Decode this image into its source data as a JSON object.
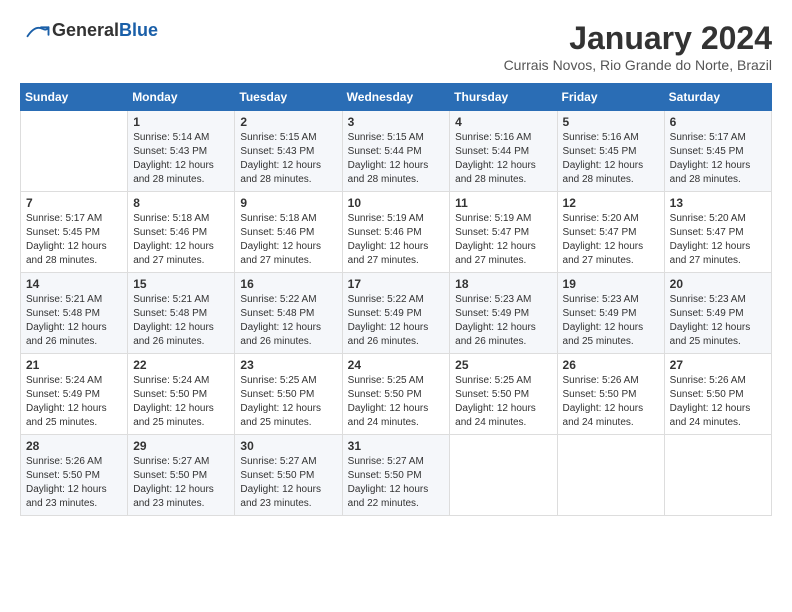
{
  "header": {
    "logo_general": "General",
    "logo_blue": "Blue",
    "title": "January 2024",
    "subtitle": "Currais Novos, Rio Grande do Norte, Brazil"
  },
  "columns": [
    "Sunday",
    "Monday",
    "Tuesday",
    "Wednesday",
    "Thursday",
    "Friday",
    "Saturday"
  ],
  "weeks": [
    [
      {
        "day": "",
        "info": ""
      },
      {
        "day": "1",
        "info": "Sunrise: 5:14 AM\nSunset: 5:43 PM\nDaylight: 12 hours\nand 28 minutes."
      },
      {
        "day": "2",
        "info": "Sunrise: 5:15 AM\nSunset: 5:43 PM\nDaylight: 12 hours\nand 28 minutes."
      },
      {
        "day": "3",
        "info": "Sunrise: 5:15 AM\nSunset: 5:44 PM\nDaylight: 12 hours\nand 28 minutes."
      },
      {
        "day": "4",
        "info": "Sunrise: 5:16 AM\nSunset: 5:44 PM\nDaylight: 12 hours\nand 28 minutes."
      },
      {
        "day": "5",
        "info": "Sunrise: 5:16 AM\nSunset: 5:45 PM\nDaylight: 12 hours\nand 28 minutes."
      },
      {
        "day": "6",
        "info": "Sunrise: 5:17 AM\nSunset: 5:45 PM\nDaylight: 12 hours\nand 28 minutes."
      }
    ],
    [
      {
        "day": "7",
        "info": "Sunrise: 5:17 AM\nSunset: 5:45 PM\nDaylight: 12 hours\nand 28 minutes."
      },
      {
        "day": "8",
        "info": "Sunrise: 5:18 AM\nSunset: 5:46 PM\nDaylight: 12 hours\nand 27 minutes."
      },
      {
        "day": "9",
        "info": "Sunrise: 5:18 AM\nSunset: 5:46 PM\nDaylight: 12 hours\nand 27 minutes."
      },
      {
        "day": "10",
        "info": "Sunrise: 5:19 AM\nSunset: 5:46 PM\nDaylight: 12 hours\nand 27 minutes."
      },
      {
        "day": "11",
        "info": "Sunrise: 5:19 AM\nSunset: 5:47 PM\nDaylight: 12 hours\nand 27 minutes."
      },
      {
        "day": "12",
        "info": "Sunrise: 5:20 AM\nSunset: 5:47 PM\nDaylight: 12 hours\nand 27 minutes."
      },
      {
        "day": "13",
        "info": "Sunrise: 5:20 AM\nSunset: 5:47 PM\nDaylight: 12 hours\nand 27 minutes."
      }
    ],
    [
      {
        "day": "14",
        "info": "Sunrise: 5:21 AM\nSunset: 5:48 PM\nDaylight: 12 hours\nand 26 minutes."
      },
      {
        "day": "15",
        "info": "Sunrise: 5:21 AM\nSunset: 5:48 PM\nDaylight: 12 hours\nand 26 minutes."
      },
      {
        "day": "16",
        "info": "Sunrise: 5:22 AM\nSunset: 5:48 PM\nDaylight: 12 hours\nand 26 minutes."
      },
      {
        "day": "17",
        "info": "Sunrise: 5:22 AM\nSunset: 5:49 PM\nDaylight: 12 hours\nand 26 minutes."
      },
      {
        "day": "18",
        "info": "Sunrise: 5:23 AM\nSunset: 5:49 PM\nDaylight: 12 hours\nand 26 minutes."
      },
      {
        "day": "19",
        "info": "Sunrise: 5:23 AM\nSunset: 5:49 PM\nDaylight: 12 hours\nand 25 minutes."
      },
      {
        "day": "20",
        "info": "Sunrise: 5:23 AM\nSunset: 5:49 PM\nDaylight: 12 hours\nand 25 minutes."
      }
    ],
    [
      {
        "day": "21",
        "info": "Sunrise: 5:24 AM\nSunset: 5:49 PM\nDaylight: 12 hours\nand 25 minutes."
      },
      {
        "day": "22",
        "info": "Sunrise: 5:24 AM\nSunset: 5:50 PM\nDaylight: 12 hours\nand 25 minutes."
      },
      {
        "day": "23",
        "info": "Sunrise: 5:25 AM\nSunset: 5:50 PM\nDaylight: 12 hours\nand 25 minutes."
      },
      {
        "day": "24",
        "info": "Sunrise: 5:25 AM\nSunset: 5:50 PM\nDaylight: 12 hours\nand 24 minutes."
      },
      {
        "day": "25",
        "info": "Sunrise: 5:25 AM\nSunset: 5:50 PM\nDaylight: 12 hours\nand 24 minutes."
      },
      {
        "day": "26",
        "info": "Sunrise: 5:26 AM\nSunset: 5:50 PM\nDaylight: 12 hours\nand 24 minutes."
      },
      {
        "day": "27",
        "info": "Sunrise: 5:26 AM\nSunset: 5:50 PM\nDaylight: 12 hours\nand 24 minutes."
      }
    ],
    [
      {
        "day": "28",
        "info": "Sunrise: 5:26 AM\nSunset: 5:50 PM\nDaylight: 12 hours\nand 23 minutes."
      },
      {
        "day": "29",
        "info": "Sunrise: 5:27 AM\nSunset: 5:50 PM\nDaylight: 12 hours\nand 23 minutes."
      },
      {
        "day": "30",
        "info": "Sunrise: 5:27 AM\nSunset: 5:50 PM\nDaylight: 12 hours\nand 23 minutes."
      },
      {
        "day": "31",
        "info": "Sunrise: 5:27 AM\nSunset: 5:50 PM\nDaylight: 12 hours\nand 22 minutes."
      },
      {
        "day": "",
        "info": ""
      },
      {
        "day": "",
        "info": ""
      },
      {
        "day": "",
        "info": ""
      }
    ]
  ]
}
